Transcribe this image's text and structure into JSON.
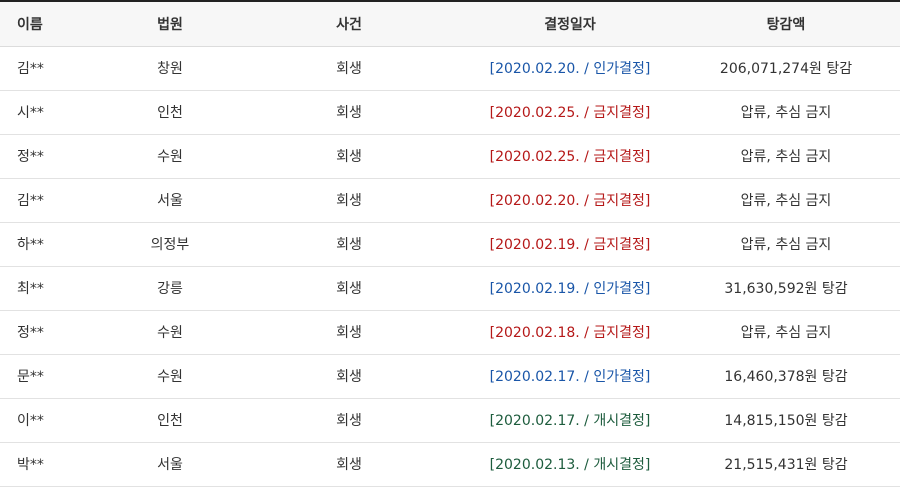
{
  "table": {
    "headers": {
      "name": "이름",
      "court": "법원",
      "case": "사건",
      "date": "결정일자",
      "amount": "탕감액"
    },
    "colors": {
      "blue": "#1a56a8",
      "red": "#b51818",
      "green": "#1d5c3d"
    },
    "rows": [
      {
        "name": "김**",
        "court": "창원",
        "case": "회생",
        "decision": "[2020.02.20. / 인가결정]",
        "decision_type": "blue",
        "amount": "206,071,274원 탕감"
      },
      {
        "name": "시**",
        "court": "인천",
        "case": "회생",
        "decision": "[2020.02.25. / 금지결정]",
        "decision_type": "red",
        "amount": "압류, 추심 금지"
      },
      {
        "name": "정**",
        "court": "수원",
        "case": "회생",
        "decision": "[2020.02.25. / 금지결정]",
        "decision_type": "red",
        "amount": "압류, 추심 금지"
      },
      {
        "name": "김**",
        "court": "서울",
        "case": "회생",
        "decision": "[2020.02.20. / 금지결정]",
        "decision_type": "red",
        "amount": "압류, 추심 금지"
      },
      {
        "name": "하**",
        "court": "의정부",
        "case": "회생",
        "decision": "[2020.02.19. / 금지결정]",
        "decision_type": "red",
        "amount": "압류, 추심 금지"
      },
      {
        "name": "최**",
        "court": "강릉",
        "case": "회생",
        "decision": "[2020.02.19. / 인가결정]",
        "decision_type": "blue",
        "amount": "31,630,592원 탕감"
      },
      {
        "name": "정**",
        "court": "수원",
        "case": "회생",
        "decision": "[2020.02.18. / 금지결정]",
        "decision_type": "red",
        "amount": "압류, 추심 금지"
      },
      {
        "name": "문**",
        "court": "수원",
        "case": "회생",
        "decision": "[2020.02.17. / 인가결정]",
        "decision_type": "blue",
        "amount": "16,460,378원 탕감"
      },
      {
        "name": "이**",
        "court": "인천",
        "case": "회생",
        "decision": "[2020.02.17. / 개시결정]",
        "decision_type": "green",
        "amount": "14,815,150원 탕감"
      },
      {
        "name": "박**",
        "court": "서울",
        "case": "회생",
        "decision": "[2020.02.13. / 개시결정]",
        "decision_type": "green",
        "amount": "21,515,431원 탕감"
      }
    ]
  }
}
